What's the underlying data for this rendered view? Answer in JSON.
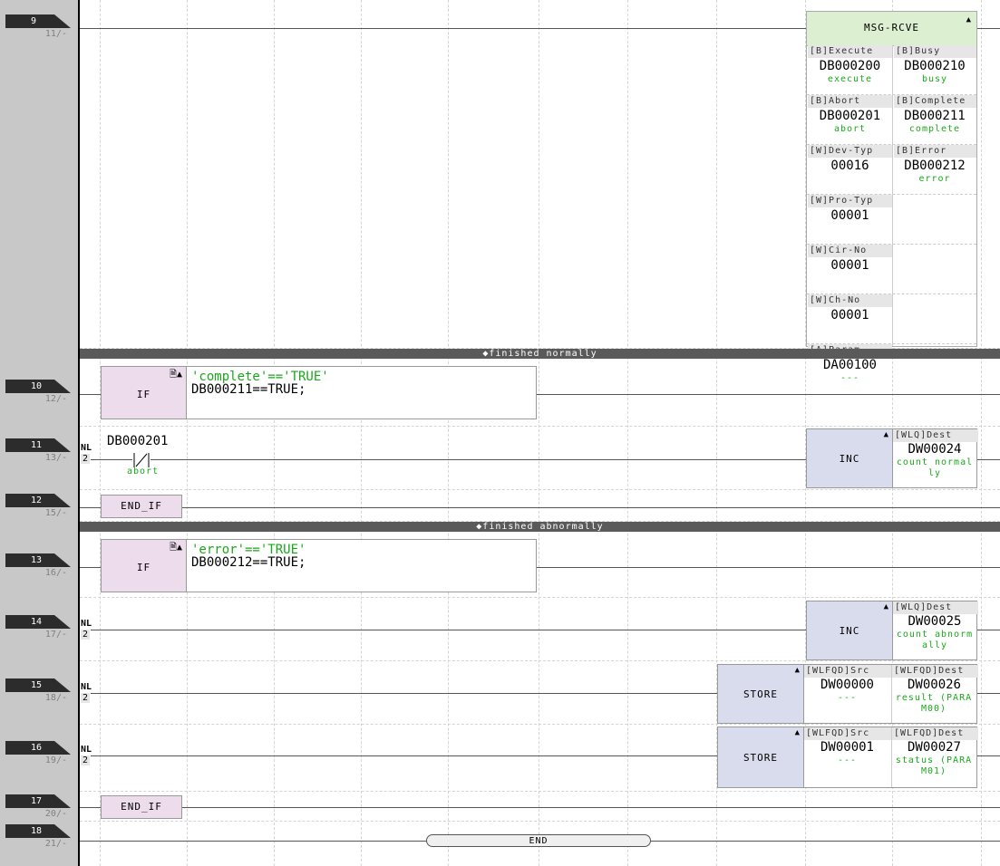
{
  "rungs": [
    {
      "num": "9",
      "sub": "11/-"
    },
    {
      "num": "10",
      "sub": "12/-"
    },
    {
      "num": "11",
      "sub": "13/-"
    },
    {
      "num": "12",
      "sub": "15/-"
    },
    {
      "num": "13",
      "sub": "16/-"
    },
    {
      "num": "14",
      "sub": "17/-"
    },
    {
      "num": "15",
      "sub": "18/-"
    },
    {
      "num": "16",
      "sub": "19/-"
    },
    {
      "num": "17",
      "sub": "20/-"
    },
    {
      "num": "18",
      "sub": "21/-"
    }
  ],
  "sections": {
    "normal": "◆finished normally",
    "abnormal": "◆finished abnormally"
  },
  "msg": {
    "title": "MSG-RCVE",
    "pins": [
      {
        "in_label": "[B]Execute",
        "in_addr": "DB000200",
        "in_cmt": "execute",
        "out_label": "[B]Busy",
        "out_addr": "DB000210",
        "out_cmt": "busy"
      },
      {
        "in_label": "[B]Abort",
        "in_addr": "DB000201",
        "in_cmt": "abort",
        "out_label": "[B]Complete",
        "out_addr": "DB000211",
        "out_cmt": "complete"
      },
      {
        "in_label": "[W]Dev-Typ",
        "in_addr": "00016",
        "in_cmt": "",
        "out_label": "[B]Error",
        "out_addr": "DB000212",
        "out_cmt": "error"
      },
      {
        "in_label": "[W]Pro-Typ",
        "in_addr": "00001",
        "in_cmt": "",
        "out_label": "",
        "out_addr": "",
        "out_cmt": ""
      },
      {
        "in_label": "[W]Cir-No",
        "in_addr": "00001",
        "in_cmt": "",
        "out_label": "",
        "out_addr": "",
        "out_cmt": ""
      },
      {
        "in_label": "[W]Ch-No",
        "in_addr": "00001",
        "in_cmt": "",
        "out_label": "",
        "out_addr": "",
        "out_cmt": ""
      },
      {
        "in_label": "[A]Param",
        "in_addr": "DA00100",
        "in_cmt": "---",
        "out_label": "",
        "out_addr": "",
        "out_cmt": ""
      }
    ]
  },
  "if1": {
    "kw": "IF",
    "comment": "'complete'=='TRUE'",
    "expr": "DB000211==TRUE;"
  },
  "if2": {
    "kw": "IF",
    "comment": "'error'=='TRUE'",
    "expr": "DB000212==TRUE;"
  },
  "endif": "END_IF",
  "contact": {
    "addr": "DB000201",
    "cmt": "abort",
    "nl": "NL",
    "nlnum": "2"
  },
  "nl": {
    "label": "NL",
    "num": "2"
  },
  "inc1": {
    "kw": "INC",
    "label": "[WLQ]Dest",
    "addr": "DW00024",
    "cmt": "count normally"
  },
  "inc2": {
    "kw": "INC",
    "label": "[WLQ]Dest",
    "addr": "DW00025",
    "cmt": "count abnormally"
  },
  "store1": {
    "kw": "STORE",
    "src_label": "[WLFQD]Src",
    "src_addr": "DW00000",
    "src_cmt": "---",
    "dst_label": "[WLFQD]Dest",
    "dst_addr": "DW00026",
    "dst_cmt": "result (PARAM00)"
  },
  "store2": {
    "kw": "STORE",
    "src_label": "[WLFQD]Src",
    "src_addr": "DW00001",
    "src_cmt": "---",
    "dst_label": "[WLFQD]Dest",
    "dst_addr": "DW00027",
    "dst_cmt": "status (PARAM01)"
  },
  "end": "END",
  "colors": {
    "fb_header": "#dcefd0",
    "if_box": "#ecdcec",
    "inst_box": "#d9dcec",
    "comment": "#1aa81a"
  }
}
